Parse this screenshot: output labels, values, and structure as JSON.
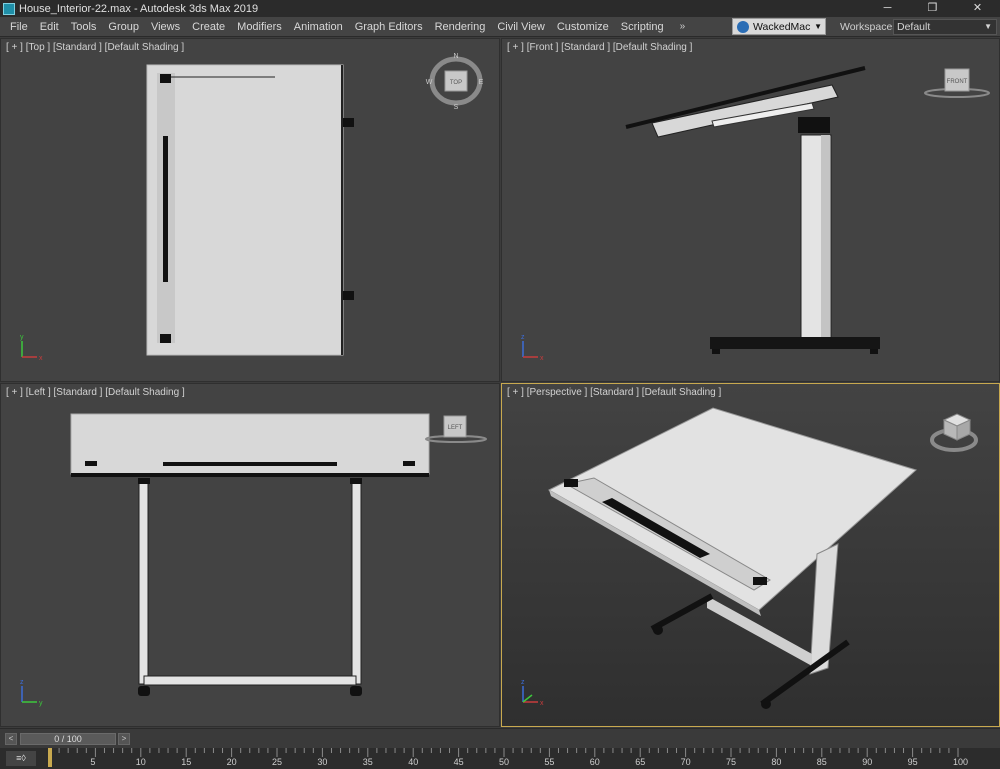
{
  "window": {
    "title": "House_Interior-22.max - Autodesk 3ds Max 2019",
    "minimize": "─",
    "maximize": "❐",
    "close": "✕"
  },
  "menu": {
    "items": [
      "File",
      "Edit",
      "Tools",
      "Group",
      "Views",
      "Create",
      "Modifiers",
      "Animation",
      "Graph Editors",
      "Rendering",
      "Civil View",
      "Customize",
      "Scripting"
    ],
    "more": "»",
    "user": "WackedMac",
    "workspaces_label": "Workspaces:",
    "workspace_value": "Default"
  },
  "viewports": {
    "top": {
      "label": "[ + ] [Top ] [Standard ] [Default Shading ]",
      "cube_face": "TOP",
      "compass": {
        "n": "N",
        "s": "S",
        "e": "E",
        "w": "W"
      }
    },
    "front": {
      "label": "[ + ] [Front ] [Standard ] [Default Shading ]",
      "cube_face": "FRONT"
    },
    "left": {
      "label": "[ + ] [Left ] [Standard ] [Default Shading ]",
      "cube_face": "LEFT"
    },
    "perspective": {
      "label": "[ + ] [Perspective ] [Standard ] [Default Shading ]"
    }
  },
  "axes": {
    "x": "x",
    "y": "y",
    "z": "z"
  },
  "timeline": {
    "frame_display": "0 / 100",
    "prev": "<",
    "next": ">",
    "ticks": [
      "5",
      "10",
      "15",
      "20",
      "25",
      "30",
      "35",
      "40",
      "45",
      "50",
      "55",
      "60",
      "65",
      "70",
      "75",
      "80",
      "85",
      "90",
      "95",
      "100"
    ],
    "key_mode": "≡◊"
  },
  "colors": {
    "accent_active_viewport": "#c8a94f",
    "axis_x": "#c83c3c",
    "axis_y": "#3cc83c",
    "axis_z": "#3c6cd8"
  }
}
